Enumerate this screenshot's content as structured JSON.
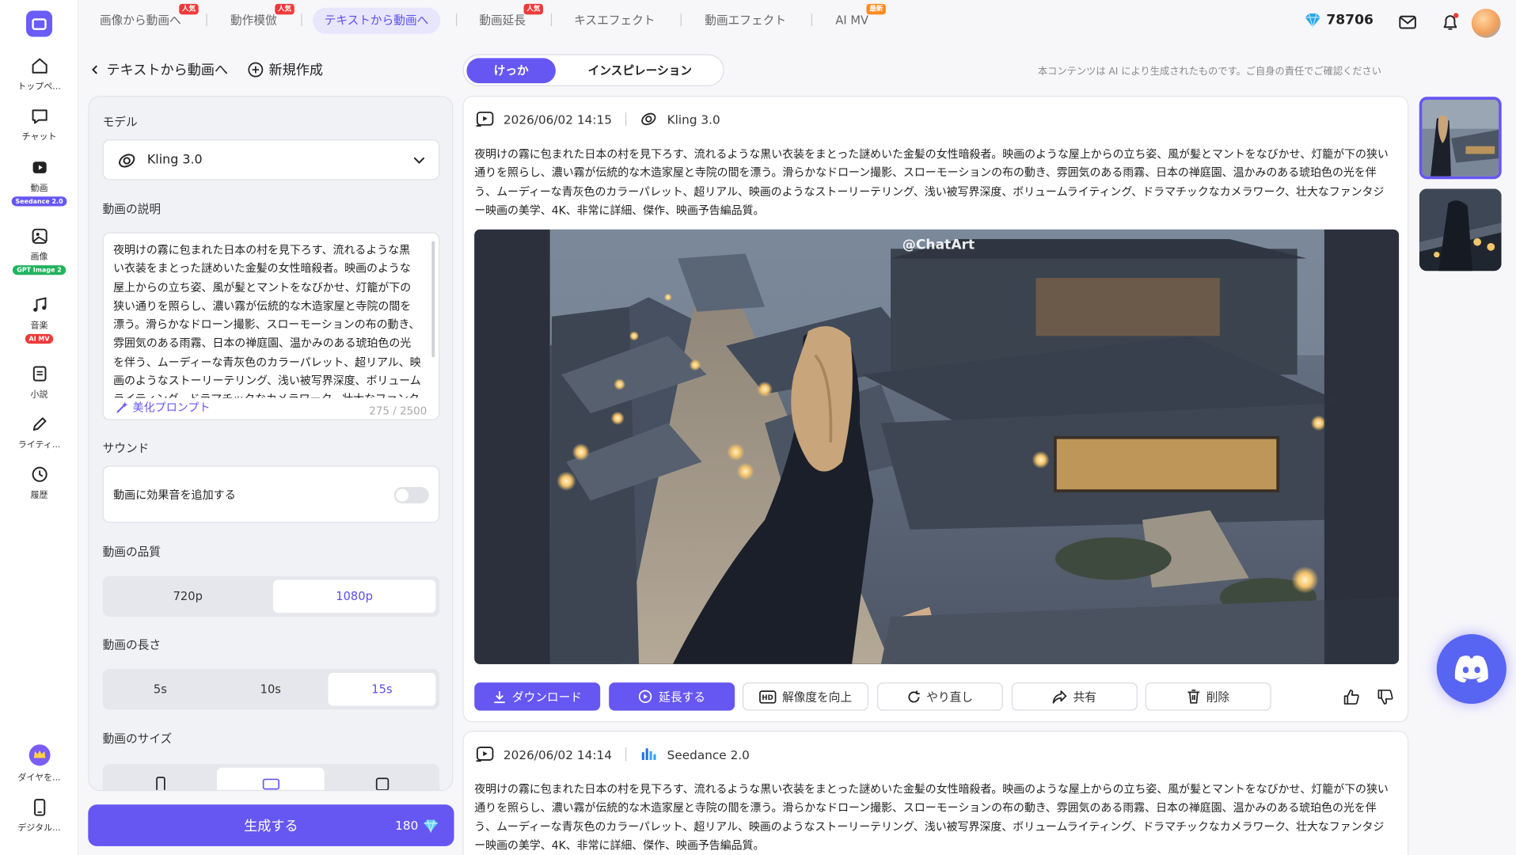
{
  "rail": {
    "items": [
      {
        "label": "トップペ...",
        "icon": "home-icon"
      },
      {
        "label": "チャット",
        "icon": "chat-icon"
      },
      {
        "label": "動画",
        "icon": "video-icon",
        "badge": "Seedance 2.0",
        "badge_color": "#6657f2"
      },
      {
        "label": "画像",
        "icon": "image-icon",
        "badge": "GPT Image 2",
        "badge_color": "#22b35e"
      },
      {
        "label": "音楽",
        "icon": "music-icon",
        "badge": "AI MV",
        "badge_color": "#f03a3a"
      },
      {
        "label": "小説",
        "icon": "book-icon"
      },
      {
        "label": "ライティ...",
        "icon": "pen-icon"
      },
      {
        "label": "履歴",
        "icon": "history-icon"
      }
    ],
    "bottom": [
      {
        "label": "ダイヤを...",
        "icon": "crown-icon"
      },
      {
        "label": "デジタル...",
        "icon": "phone-icon"
      }
    ]
  },
  "tabs": [
    {
      "label": "画像から動画へ",
      "badge": "人気"
    },
    {
      "label": "動作模倣",
      "badge": "人気"
    },
    {
      "label": "テキストから動画へ",
      "active": true
    },
    {
      "label": "動画延長",
      "badge": "人気"
    },
    {
      "label": "キスエフェクト"
    },
    {
      "label": "動画エフェクト"
    },
    {
      "label": "AI MV",
      "badge": "最新"
    }
  ],
  "header": {
    "gems": "78706"
  },
  "back": {
    "label": "テキストから動画へ",
    "new_label": "新規作成"
  },
  "panel": {
    "model_label": "モデル",
    "model_value": "Kling 3.0",
    "desc_label": "動画の説明",
    "desc_text": "夜明けの霧に包まれた日本の村を見下ろす、流れるような黒い衣装をまとった謎めいた金髪の女性暗殺者。映画のような屋上からの立ち姿、風が髪とマントをなびかせ、灯籠が下の狭い通りを照らし、濃い霧が伝統的な木造家屋と寺院の間を漂う。滑らかなドローン撮影、スローモーションの布の動き、雰囲気のある雨霧、日本の禅庭園、温かみのある琥珀色の光を伴う、ムーディーな青灰色のカラーパレット、超リアル、映画のようなストーリーテリング、浅い被写界深度、ボリュームライティング、ドラマチックなカメラワーク、壮大なファンタジー映画の美学、4K、非常に詳細、傑作、映画予告編品質。",
    "beautify": "美化プロンプト",
    "char_count": "275 / 2500",
    "sound_label": "サウンド",
    "sound_option": "動画に効果音を追加する",
    "sound_on": false,
    "quality_label": "動画の品質",
    "quality_options": [
      "720p",
      "1080p"
    ],
    "quality_selected": "1080p",
    "length_label": "動画の長さ",
    "length_options": [
      "5s",
      "10s",
      "15s"
    ],
    "length_selected": "15s",
    "size_label": "動画のサイズ",
    "size_options": [
      "portrait",
      "landscape",
      "square"
    ],
    "size_selected": "landscape",
    "generate_label": "生成する",
    "generate_cost": "180"
  },
  "modes": [
    "けっか",
    "インスピレーション"
  ],
  "disclaimer": "本コンテンツは AI により生成されたものです。ご自身の責任でご確認ください",
  "results": [
    {
      "datetime": "2026/06/02 14:15",
      "model": "Kling 3.0",
      "prompt": "夜明けの霧に包まれた日本の村を見下ろす、流れるような黒い衣装をまとった謎めいた金髪の女性暗殺者。映画のような屋上からの立ち姿、風が髪とマントをなびかせ、灯籠が下の狭い通りを照らし、濃い霧が伝統的な木造家屋と寺院の間を漂う。滑らかなドローン撮影、スローモーションの布の動き、雰囲気のある雨霧、日本の禅庭園、温かみのある琥珀色の光を伴う、ムーディーな青灰色のカラーパレット、超リアル、映画のようなストーリーテリング、浅い被写界深度、ボリュームライティング、ドラマチックなカメラワーク、壮大なファンタジー映画の美学、4K、非常に詳細、傑作、映画予告編品質。",
      "watermark": "@ChatArt"
    },
    {
      "datetime": "2026/06/02 14:14",
      "model": "Seedance 2.0",
      "prompt": "夜明けの霧に包まれた日本の村を見下ろす、流れるような黒い衣装をまとった謎めいた金髪の女性暗殺者。映画のような屋上からの立ち姿、風が髪とマントをなびかせ、灯籠が下の狭い通りを照らし、濃い霧が伝統的な木造家屋と寺院の間を漂う。滑らかなドローン撮影、スローモーションの布の動き、雰囲気のある雨霧、日本の禅庭園、温かみのある琥珀色の光を伴う、ムーディーな青灰色のカラーパレット、超リアル、映画のようなストーリーテリング、浅い被写界深度、ボリュームライティング、ドラマチックなカメラワーク、壮大なファンタジー映画の美学、4K、非常に詳細、傑作、映画予告編品質。"
    }
  ],
  "actions": [
    "ダウンロード",
    "延長する",
    "解像度を向上",
    "やり直し",
    "共有",
    "削除"
  ],
  "accent": "#6657f2"
}
